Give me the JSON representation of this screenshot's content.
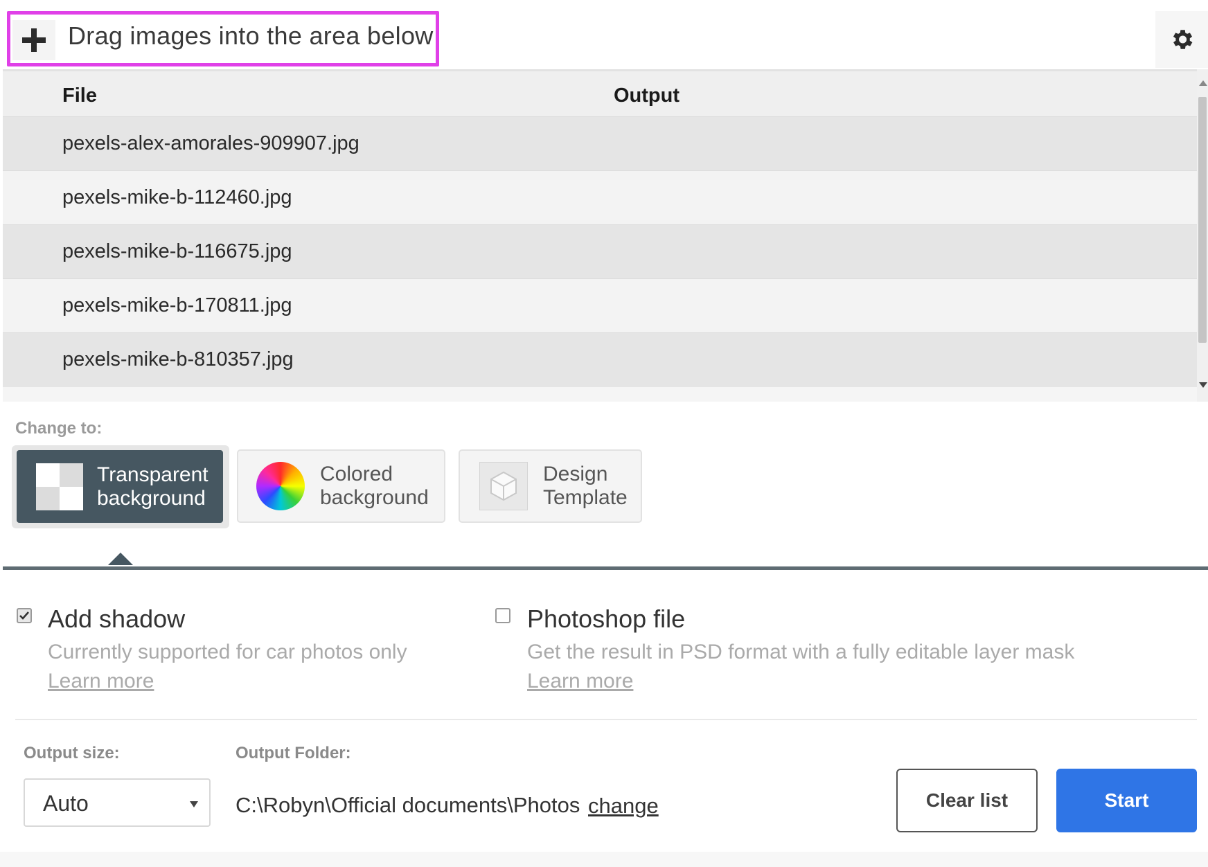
{
  "header": {
    "drag_text": "Drag images into the area below",
    "add_icon": "plus-icon",
    "settings_icon": "gear-icon"
  },
  "table": {
    "columns": [
      "File",
      "Output"
    ],
    "rows": [
      {
        "file": "pexels-alex-amorales-909907.jpg",
        "output": ""
      },
      {
        "file": "pexels-mike-b-112460.jpg",
        "output": ""
      },
      {
        "file": "pexels-mike-b-116675.jpg",
        "output": ""
      },
      {
        "file": "pexels-mike-b-170811.jpg",
        "output": ""
      },
      {
        "file": "pexels-mike-b-810357.jpg",
        "output": ""
      }
    ]
  },
  "change_to": {
    "label": "Change to:",
    "options": [
      {
        "line1": "Transparent",
        "line2": "background",
        "icon": "checkerboard-icon",
        "selected": true
      },
      {
        "line1": "Colored",
        "line2": "background",
        "icon": "color-wheel-icon",
        "selected": false
      },
      {
        "line1": "Design",
        "line2": "Template",
        "icon": "design-template-icon",
        "selected": false
      }
    ]
  },
  "options": {
    "shadow": {
      "title": "Add shadow",
      "desc": "Currently supported for car photos only",
      "link": "Learn more",
      "checked": true
    },
    "photoshop": {
      "title": "Photoshop file",
      "desc": "Get the result in PSD format with a fully editable layer mask",
      "link": "Learn more",
      "checked": false
    }
  },
  "output": {
    "size_label": "Output size:",
    "size_value": "Auto",
    "folder_label": "Output Folder:",
    "folder_path": "C:\\Robyn\\Official documents\\Photos",
    "change_link": "change"
  },
  "actions": {
    "clear_label": "Clear list",
    "start_label": "Start"
  },
  "colors": {
    "highlight_border": "#e040e8",
    "selected_mode": "#465761",
    "primary_button": "#2f75e6"
  }
}
